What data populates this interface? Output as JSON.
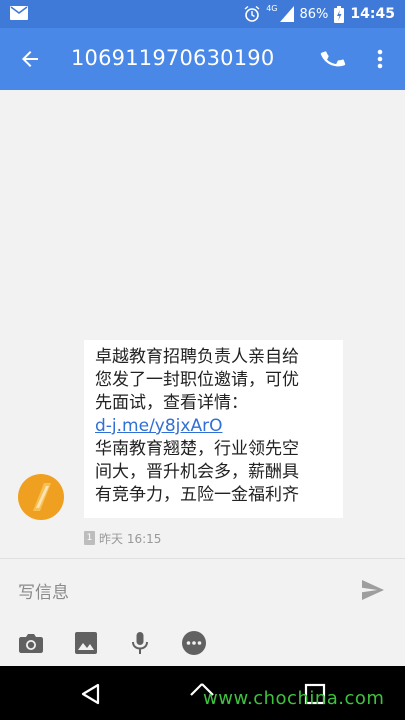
{
  "status_bar": {
    "network": "4G",
    "battery": "86%",
    "time": "14:45"
  },
  "header": {
    "title": "106911970630190",
    "icons": [
      "back-arrow-icon",
      "phone-icon",
      "more-vert-icon"
    ]
  },
  "message": {
    "lines": [
      "卓越教育招聘负责人亲自给",
      "您发了一封职位邀请，可优",
      "先面试，查看详情：",
      "华南教育翘楚，行业领先空",
      "间大，晋升机会多，薪酬具",
      "有竞争力，五险一金福利齐"
    ],
    "link": "d-j.me/y8jxArO",
    "sim": "1",
    "timestamp": "昨天 16:15"
  },
  "compose": {
    "placeholder": "写信息",
    "attach_icons": [
      "camera-icon",
      "image-icon",
      "microphone-icon",
      "emoji-icon"
    ]
  },
  "nav_icons": [
    "back-triangle-icon",
    "home-icon",
    "recents-icon"
  ],
  "watermark": "www.chochina.com",
  "colors": {
    "status_bar": "#3f7ad9",
    "app_bar": "#4a88e8",
    "link": "#2f6fd6",
    "avatar": "#f0a020",
    "watermark": "#3fc23f"
  }
}
